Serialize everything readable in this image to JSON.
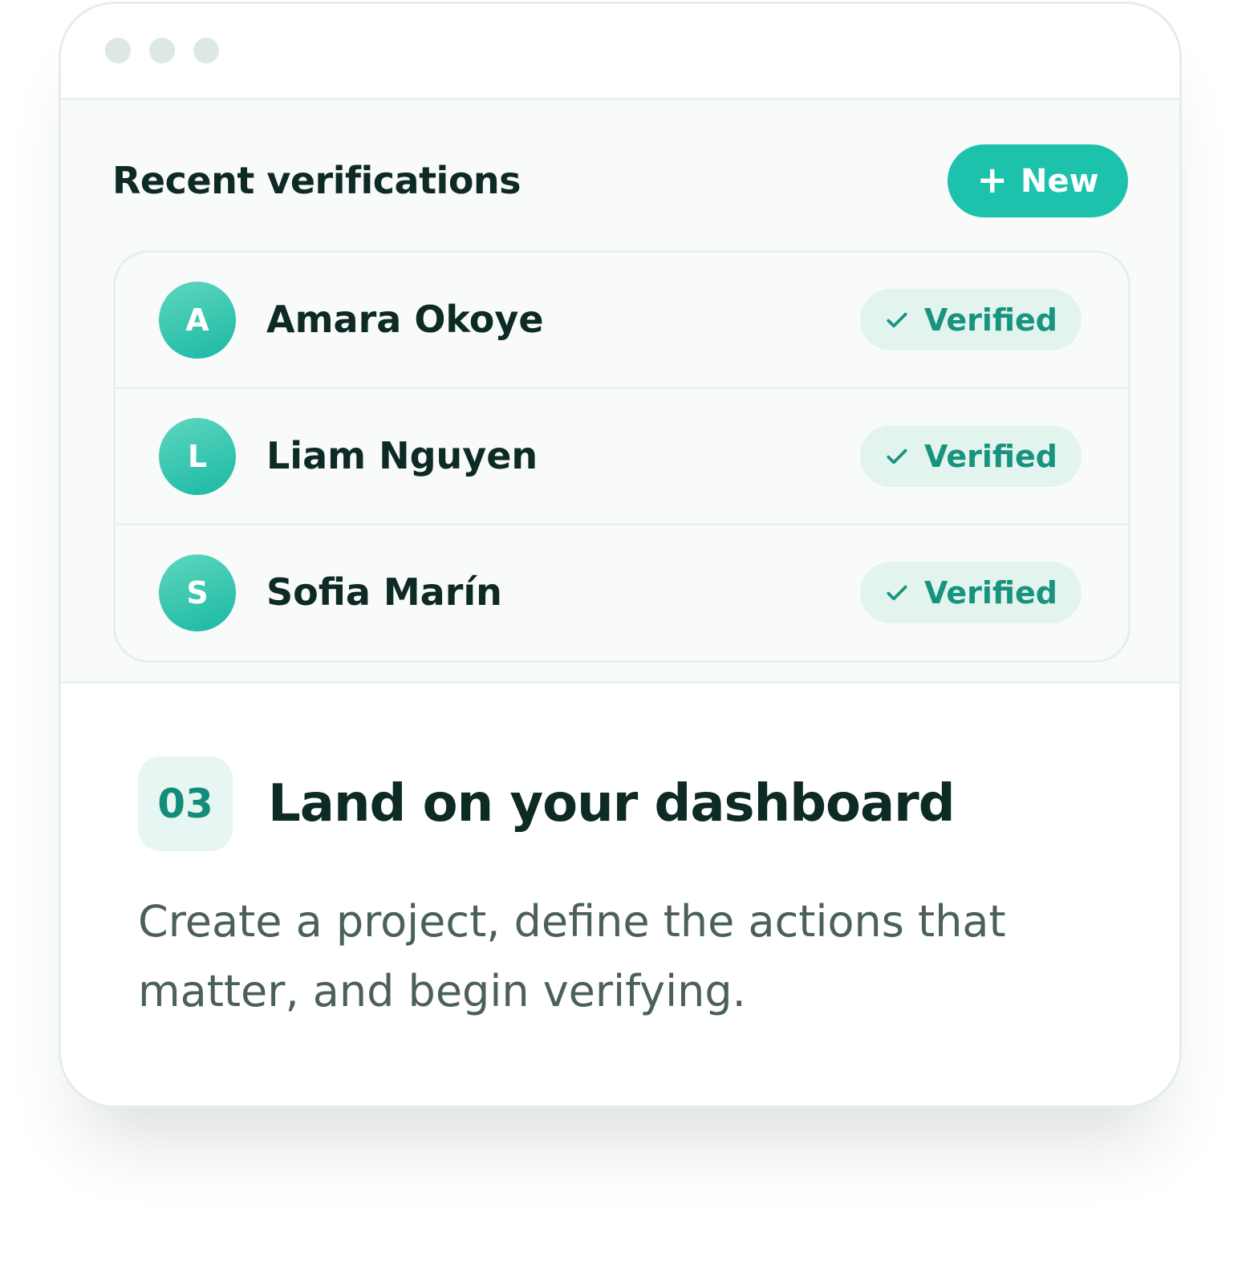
{
  "panel": {
    "title": "Recent verifications",
    "new_button": {
      "icon": "plus-icon",
      "glyph": "+",
      "label": "New"
    }
  },
  "verifications": [
    {
      "initial": "A",
      "name": "Amara Okoye",
      "status": "Verified"
    },
    {
      "initial": "L",
      "name": "Liam Nguyen",
      "status": "Verified"
    },
    {
      "initial": "S",
      "name": "Sofia Marín",
      "status": "Verified"
    }
  ],
  "step": {
    "number": "03",
    "title": "Land on your dashboard",
    "description": "Create a project, define the actions that matter, and begin verifying."
  },
  "colors": {
    "accent": "#1cc2ac",
    "badge_bg": "#e3f3ee",
    "badge_text": "#17937f",
    "heading": "#0d2a24",
    "body_text": "#4b605a"
  }
}
